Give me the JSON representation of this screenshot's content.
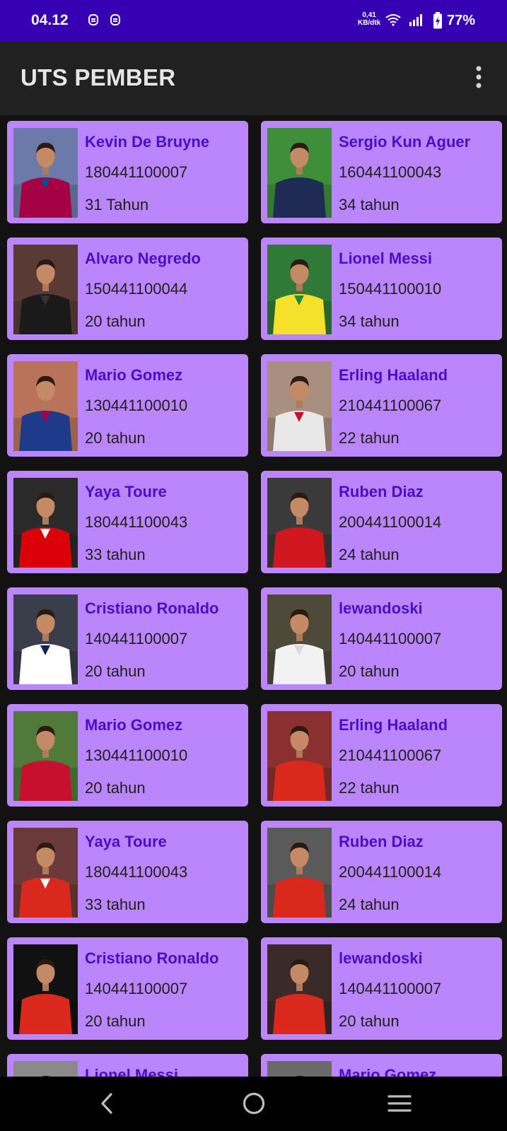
{
  "status_bar": {
    "time": "04.12",
    "network_speed_value": "0,41",
    "network_speed_unit": "KB/dtk",
    "battery_percent": "77%",
    "icons": [
      "notification-icon",
      "notification-icon",
      "wifi-icon",
      "signal-icon",
      "battery-charging-icon"
    ]
  },
  "app_bar": {
    "title": "UTS PEMBER",
    "menu_icon": "more-vert-icon"
  },
  "players": [
    {
      "name": "Kevin De Bruyne",
      "nim": "180441100007",
      "age": "31 Tahun",
      "jersey": "#a50044",
      "jersey2": "#004d98",
      "bg": "#6b7aa8"
    },
    {
      "name": "Sergio Kun Aguer",
      "nim": "160441100043",
      "age": "34 tahun",
      "jersey": "#1f2a55",
      "jersey2": "#1f2a55",
      "bg": "#3f8f3a"
    },
    {
      "name": "Alvaro Negredo",
      "nim": "150441100044",
      "age": "20 tahun",
      "jersey": "#1a1a1a",
      "jersey2": "#333333",
      "bg": "#5a3a35"
    },
    {
      "name": "Lionel Messi",
      "nim": "150441100010",
      "age": "34 tahun",
      "jersey": "#f5e12a",
      "jersey2": "#1b8a3c",
      "bg": "#2e7a36"
    },
    {
      "name": "Mario Gomez",
      "nim": "130441100010",
      "age": "20 tahun",
      "jersey": "#1e3a8a",
      "jersey2": "#a50044",
      "bg": "#b9735a"
    },
    {
      "name": "Erling Haaland",
      "nim": "210441100067",
      "age": "22 tahun",
      "jersey": "#e8e8e8",
      "jersey2": "#c8102e",
      "bg": "#a88f80"
    },
    {
      "name": "Yaya Toure",
      "nim": "180441100043",
      "age": "33 tahun",
      "jersey": "#db0007",
      "jersey2": "#ffffff",
      "bg": "#2a2a2a"
    },
    {
      "name": "Ruben Diaz",
      "nim": "200441100014",
      "age": "24 tahun",
      "jersey": "#d0161e",
      "jersey2": "#d0161e",
      "bg": "#3a3a3a"
    },
    {
      "name": "Cristiano Ronaldo",
      "nim": "140441100007",
      "age": "20 tahun",
      "jersey": "#ffffff",
      "jersey2": "#132257",
      "bg": "#3a3d4a"
    },
    {
      "name": "lewandoski",
      "nim": "140441100007",
      "age": "20 tahun",
      "jersey": "#f2f2f2",
      "jersey2": "#d8d8d8",
      "bg": "#4d4a3a"
    },
    {
      "name": "Mario Gomez",
      "nim": "130441100010",
      "age": "20 tahun",
      "jersey": "#c8102e",
      "jersey2": "#c8102e",
      "bg": "#4f7a3a"
    },
    {
      "name": "Erling Haaland",
      "nim": "210441100067",
      "age": "22 tahun",
      "jersey": "#da291c",
      "jersey2": "#da291c",
      "bg": "#8a3030"
    },
    {
      "name": "Yaya Toure",
      "nim": "180441100043",
      "age": "33 tahun",
      "jersey": "#da291c",
      "jersey2": "#ffffff",
      "bg": "#6a3a3a"
    },
    {
      "name": "Ruben Diaz",
      "nim": "200441100014",
      "age": "24 tahun",
      "jersey": "#da291c",
      "jersey2": "#da291c",
      "bg": "#5a5a5a"
    },
    {
      "name": "Cristiano Ronaldo",
      "nim": "140441100007",
      "age": "20 tahun",
      "jersey": "#da291c",
      "jersey2": "#da291c",
      "bg": "#111111"
    },
    {
      "name": "lewandoski",
      "nim": "140441100007",
      "age": "20 tahun",
      "jersey": "#da291c",
      "jersey2": "#da291c",
      "bg": "#3a2a2a"
    },
    {
      "name": "Lionel Messi",
      "nim": "",
      "age": "",
      "jersey": "#cfcfcf",
      "jersey2": "#cfcfcf",
      "bg": "#8a8a8a"
    },
    {
      "name": "Mario Gomez",
      "nim": "",
      "age": "",
      "jersey": "#e8e8e8",
      "jersey2": "#e8e8e8",
      "bg": "#6a6a6a"
    }
  ],
  "nav_bar": {
    "icons": [
      "back-icon",
      "home-icon",
      "recents-icon"
    ]
  },
  "colors": {
    "status_bar": "#3700b3",
    "app_bar": "#212121",
    "background": "#121212",
    "card": "#bb86fc",
    "name_text": "#4a0ec7"
  }
}
